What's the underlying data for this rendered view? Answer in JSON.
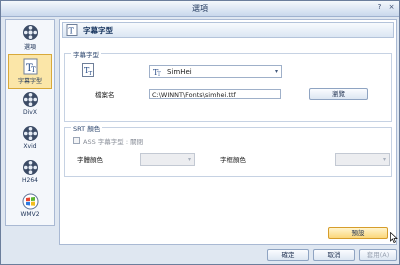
{
  "window": {
    "title": "選項",
    "help": "?",
    "close": "×"
  },
  "sidebar": {
    "items": [
      {
        "label": "選項"
      },
      {
        "label": "字幕字型"
      },
      {
        "label": "DivX"
      },
      {
        "label": "Xvid"
      },
      {
        "label": "H264"
      },
      {
        "label": "WMV2"
      }
    ]
  },
  "panel": {
    "title": "字幕字型"
  },
  "font_group": {
    "legend": "字幕字型",
    "font_value": "SimHei",
    "file_label": "檔案名",
    "file_value": "C:\\WINNT\\Fonts\\simhei.ttf",
    "browse_label": "瀏覽"
  },
  "srt_group": {
    "legend": "SRT 顏色",
    "ass_label": "ASS 字幕字型 : 關閉",
    "text_color_label": "字體顏色",
    "border_color_label": "字框顏色"
  },
  "buttons": {
    "default": "預設",
    "ok": "確定",
    "cancel": "取消",
    "apply": "套用(A)"
  }
}
